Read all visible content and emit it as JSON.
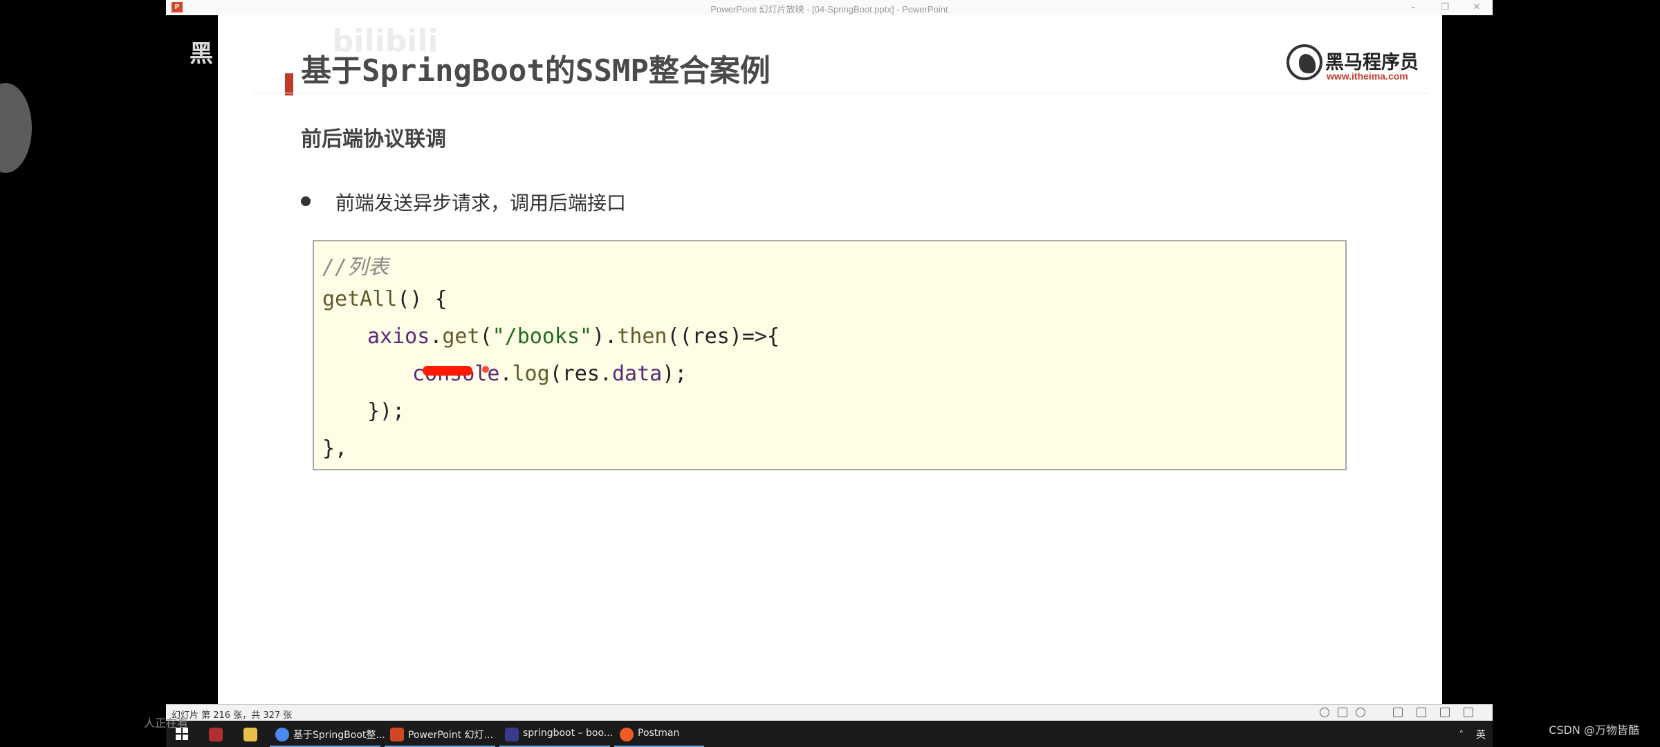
{
  "window": {
    "title": "PowerPoint 幻灯片放映 - [04-SpringBoot.pptx] - PowerPoint",
    "app_icon": "P",
    "controls": [
      "–",
      "❐",
      "✕"
    ]
  },
  "slide": {
    "title": "基于SpringBoot的SSMP整合案例",
    "logo": {
      "cn": "黑马程序员",
      "url": "www.itheima.com"
    },
    "section_title": "前后端协议联调",
    "bullet": "前端发送异步请求，调用后端接口",
    "code": {
      "comment": "//列表",
      "fn_decl": "getAll",
      "fn_decl_rest": "() {",
      "axios": "axios",
      "dot1": ".",
      "get": "get",
      "paren1": "(",
      "url": "\"/books\"",
      "paren2": ").",
      "then": "then",
      "then_args": "((res)=>{",
      "console": "console",
      "dot2": ".",
      "log": "log",
      "log_open": "(res.",
      "data": "data",
      "log_close": ");",
      "close_then": "});",
      "close_fn": "},"
    },
    "progress": 0.86
  },
  "status": {
    "slide_info": "幻灯片 第 216 张，共 327 张"
  },
  "taskbar": {
    "items": [
      {
        "label": "基于SpringBoot整...",
        "icon": "chrome-icon",
        "color": "#4a8af4"
      },
      {
        "label": "PowerPoint 幻灯...",
        "icon": "powerpoint-icon",
        "color": "#d24726"
      },
      {
        "label": "springboot – boo...",
        "icon": "intellij-icon",
        "color": "#3a3a8a"
      },
      {
        "label": "Postman",
        "icon": "postman-icon",
        "color": "#ef5b25"
      }
    ],
    "tray_lang": "英"
  },
  "overlays": {
    "watermark_left": "黑",
    "watermark_bili": "bilibili",
    "viewer_text": "人正在看",
    "csdn": "CSDN @万物皆酷"
  }
}
